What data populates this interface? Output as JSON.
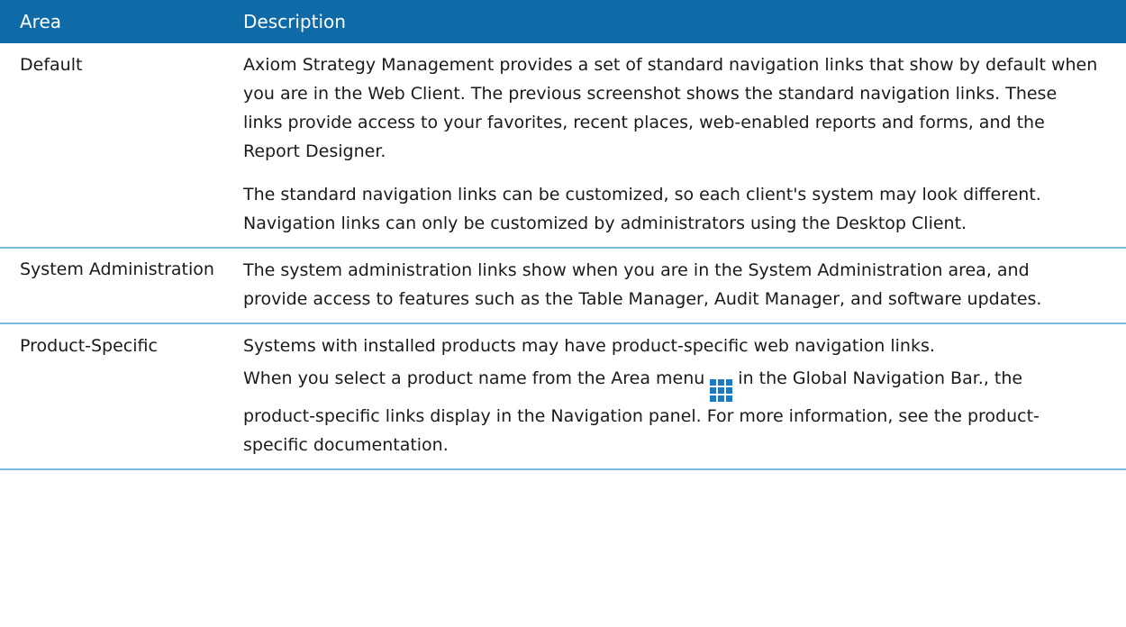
{
  "table": {
    "headers": {
      "area": "Area",
      "description": "Description"
    },
    "rows": [
      {
        "area": "Default",
        "paragraphs": [
          "Axiom Strategy Management provides a set of standard navigation links that show by default when you are in the Web Client. The previous screenshot shows the standard navigation links. These links provide access to your favorites, recent places, web-enabled reports and forms, and the Report Designer.",
          "The standard navigation links can be customized, so each client's system may look different. Navigation links can only be customized by administrators using the Desktop Client."
        ]
      },
      {
        "area": "System Administration",
        "paragraphs": [
          "The system administration links show when you are in the System Administration area, and provide access to features such as the Table Manager, Audit Manager, and software updates."
        ]
      },
      {
        "area": "Product-Specific",
        "paragraph1": "Systems with installed products may have product-specific web navigation links.",
        "paragraph2_before_icon": "When you select a product name from the Area menu",
        "icon": "area-menu-grid-icon",
        "paragraph2_after_icon": "in the Global Navigation Bar., the product-specific links display in the Navigation panel. For more information, see the product-specific documentation."
      }
    ]
  },
  "colors": {
    "header_bg": "#0f6ba7",
    "row_border": "#79b8de",
    "icon": "#1a7bc4"
  }
}
